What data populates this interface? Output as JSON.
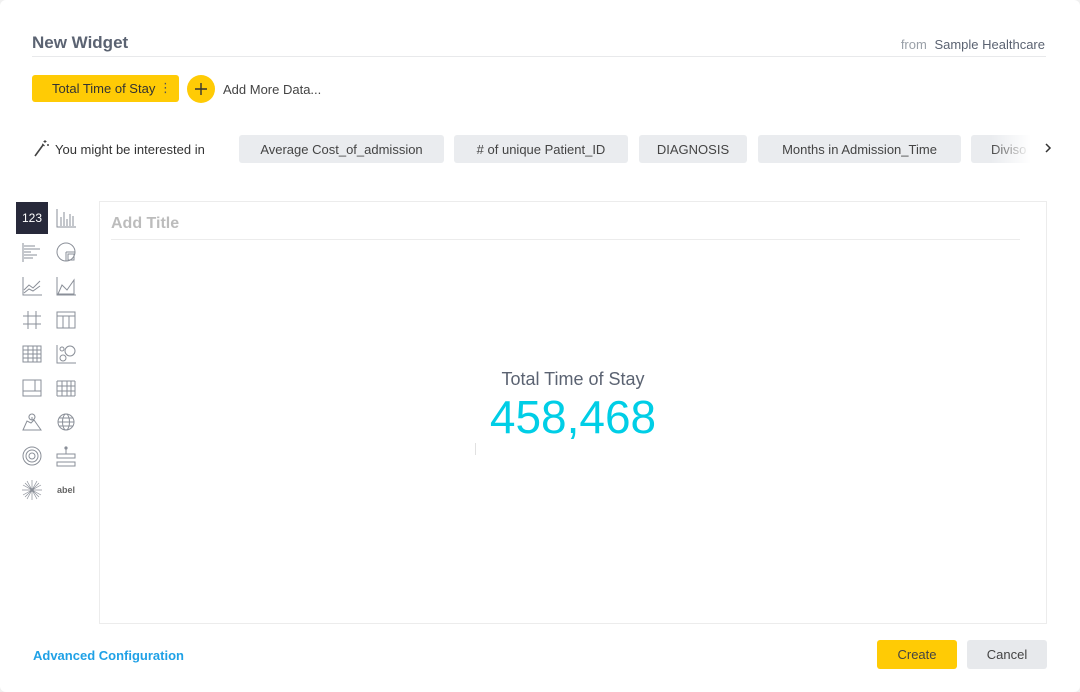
{
  "header": {
    "title": "New Widget",
    "from_label": "from",
    "source_name": "Sample Healthcare"
  },
  "data_panel": {
    "chip_label": "Total Time of Stay",
    "chip_menu_icon": "vertical-dots-icon",
    "add_icon": "plus-icon",
    "add_label": "Add More Data..."
  },
  "suggestions": {
    "icon": "magic-wand-icon",
    "label": "You might be interested in",
    "chips": [
      "Average Cost_of_admission",
      "# of unique Patient_ID",
      "DIAGNOSIS",
      "Months in Admission_Time",
      "Diviso"
    ],
    "next_icon": "chevron-right-icon"
  },
  "palette": {
    "indicator_label": "123",
    "label_tile": "abel",
    "icons": [
      "indicator-icon",
      "column-chart-icon",
      "bar-chart-icon",
      "pie-chart-icon",
      "line-chart-icon",
      "area-chart-icon",
      "table-icon",
      "table-columns-icon",
      "pivot-table-icon",
      "scatter-icon",
      "treemap-icon",
      "heatmap-icon",
      "map-icon",
      "globe-icon",
      "sunburst-icon",
      "funnel-icon",
      "starburst-icon",
      "label-icon"
    ]
  },
  "canvas": {
    "title_placeholder": "Add Title",
    "kpi_label": "Total Time of Stay",
    "kpi_value": "458,468",
    "accent_color": "#00cee6"
  },
  "footer": {
    "advanced_label": "Advanced Configuration",
    "create_label": "Create",
    "cancel_label": "Cancel"
  },
  "colors": {
    "primary": "#ffcb05",
    "link": "#1fa1e6",
    "active_tile": "#27293a"
  }
}
